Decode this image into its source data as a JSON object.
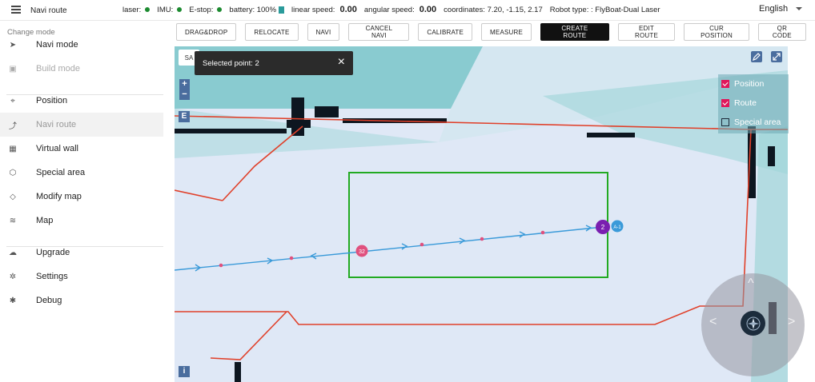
{
  "header": {
    "app_title": "Navi route",
    "status": {
      "laser_label": "laser:",
      "imu_label": "IMU:",
      "estop_label": "E-stop:",
      "battery_label": "battery:",
      "battery_value": "100%",
      "linear_label": "linear speed:",
      "linear_value": "0.00",
      "angular_label": "angular speed:",
      "angular_value": "0.00",
      "coords_label": "coordinates:",
      "coords_value": "7.20,  -1.15,  2.17",
      "robot_type_label": "Robot type: :",
      "robot_type_value": "FlyBoat-Dual Laser"
    },
    "language": "English",
    "status_ok_color": "#1b8a2f"
  },
  "sidebar": {
    "section_label": "Change mode",
    "items": [
      {
        "label": "Navi mode",
        "icon": "send-icon",
        "glyph": "➤",
        "state": "normal"
      },
      {
        "label": "Build mode",
        "icon": "build-icon",
        "glyph": "▣",
        "state": "disabled"
      },
      {
        "label": "Position",
        "icon": "location-pin-icon",
        "glyph": "⌖",
        "state": "normal"
      },
      {
        "label": "Navi route",
        "icon": "route-icon",
        "glyph": "⤴",
        "state": "active"
      },
      {
        "label": "Virtual wall",
        "icon": "wall-icon",
        "glyph": "▦",
        "state": "normal"
      },
      {
        "label": "Special area",
        "icon": "area-icon",
        "glyph": "⬡",
        "state": "normal"
      },
      {
        "label": "Modify map",
        "icon": "edit-map-icon",
        "glyph": "◇",
        "state": "normal"
      },
      {
        "label": "Map",
        "icon": "layers-icon",
        "glyph": "≋",
        "state": "normal"
      },
      {
        "label": "Upgrade",
        "icon": "cloud-upload-icon",
        "glyph": "☁",
        "state": "normal"
      },
      {
        "label": "Settings",
        "icon": "gear-icon",
        "glyph": "✲",
        "state": "normal"
      },
      {
        "label": "Debug",
        "icon": "bug-icon",
        "glyph": "✱",
        "state": "normal"
      }
    ]
  },
  "toolbar": {
    "buttons": [
      {
        "label": "DRAG&DROP",
        "active": false
      },
      {
        "label": "RELOCATE",
        "active": false
      },
      {
        "label": "NAVI",
        "active": false
      },
      {
        "label": "CANCEL NAVI",
        "active": false
      },
      {
        "label": "CALIBRATE",
        "active": false
      },
      {
        "label": "MEASURE",
        "active": false
      },
      {
        "label": "CREATE ROUTE",
        "active": true
      },
      {
        "label": "EDIT ROUTE",
        "active": false
      },
      {
        "label": "CUR POSITION",
        "active": false
      },
      {
        "label": "QR CODE",
        "active": false
      }
    ]
  },
  "map": {
    "toast_text": "Selected point: 2",
    "save_chip_label": "SA",
    "zoom_in": "+",
    "zoom_out": "−",
    "e_label": "E",
    "info_label": "i",
    "layers": [
      {
        "label": "Position",
        "checked": true
      },
      {
        "label": "Route",
        "checked": true
      },
      {
        "label": "Special area",
        "checked": false
      }
    ],
    "route_points": {
      "start_label": "32",
      "end_label": "2",
      "robot_label": "A-1"
    },
    "joystick": {
      "up": "^",
      "left": "<",
      "right": ">"
    },
    "colors": {
      "background": "#dfe8f6",
      "obstacle_area": "#7fc8cc",
      "wall_line": "#e0402a",
      "route_line": "#3a9ad9",
      "selection_box": "#22aa22",
      "start_marker": "#e0507e",
      "end_marker": "#7a1fb0",
      "robot_marker": "#3a9ad9"
    }
  }
}
